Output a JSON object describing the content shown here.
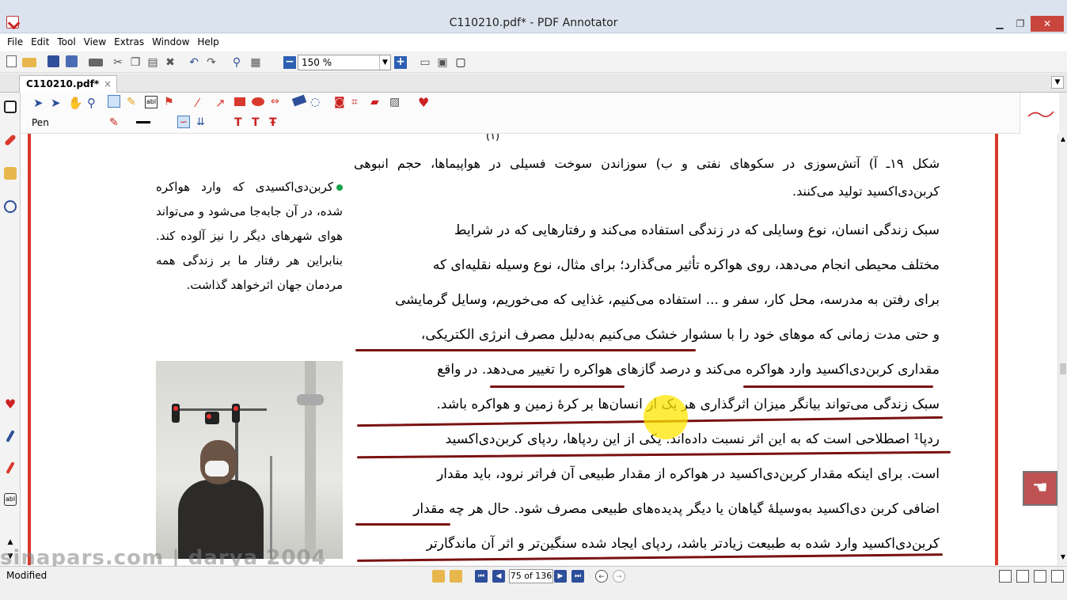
{
  "window": {
    "title": "C110210.pdf* - PDF Annotator",
    "controls": [
      "▁",
      "❐",
      "✕"
    ]
  },
  "menu": [
    "File",
    "Edit",
    "Tool",
    "View",
    "Extras",
    "Window",
    "Help"
  ],
  "toolbar": {
    "zoom_value": "150 %"
  },
  "tab": {
    "label": "C110210.pdf*",
    "close": "×"
  },
  "pen_label": "Pen",
  "page": {
    "fig_marker": "(۱)",
    "caption": "شکل ۱۹ـ آ) آتش‌سوزی در سکوهای نفتی و ب) سوزاندن سوخت فسیلی در هواپیماها، حجم انبوهی کربن‌دی‌اکسید تولید می‌کنند.",
    "body_lines": [
      "سبک زندگی انسان، نوع وسایلی که در زندگی استفاده می‌کند و رفتارهایی که در شرایط",
      "مختلف محیطی انجام می‌دهد، روی هواکره تأثیر می‌گذارد؛ برای مثال، نوع وسیله نقلیه‌ای که",
      "برای رفتن به مدرسه، محل کار، سفر و ... استفاده می‌کنیم، غذایی که می‌خوریم، وسایل گرمایشی",
      "و حتی مدت زمانی که موهای خود را با سشوار خشک می‌کنیم به‌دلیل مصرف انرژی الکتریکی،",
      "مقداری کربن‌دی‌اکسید وارد هواکره می‌کند و درصد گازهای هواکره را تغییر می‌دهد. در واقع",
      "سبک زندگی می‌تواند بیانگر میزان اثرگذاری هر یک از انسان‌ها بر کرهٔ زمین و هواکره باشد.",
      "ردپا¹ اصطلاحی است که به این اثر نسبت داده‌اند. یکی از این ردپاها، ردپای کربن‌دی‌اکسید",
      "است. برای اینکه مقدار کربن‌دی‌اکسید در هواکره از مقدار طبیعی آن فراتر نرود، باید مقدار",
      "اضافی کربن دی‌اکسید به‌وسیلهٔ گیاهان یا دیگر پدیده‌های طبیعی مصرف شود. حال هر چه مقدار",
      "کربن‌دی‌اکسید وارد شده به طبیعت زیادتر باشد، ردپای ایجاد شده سنگین‌تر و اثر آن ماندگارتر"
    ],
    "side_note": "کربن‌دی‌اکسیدی که وارد هواکره شده، در آن جابه‌جا می‌شود و می‌تواند هوای شهرهای دیگر را نیز آلوده کند. بنابراین هر رفتار ما بر زندگی همه مردمان جهان اثرخواهد گذاشت."
  },
  "watermark": "sinapars.com  |  darya 2004",
  "status": {
    "text": "Modified",
    "page_indicator": "75 of 136"
  },
  "colors": {
    "accent_red": "#d9382c",
    "ink": "#7a1111",
    "highlight": "#ffe600"
  }
}
